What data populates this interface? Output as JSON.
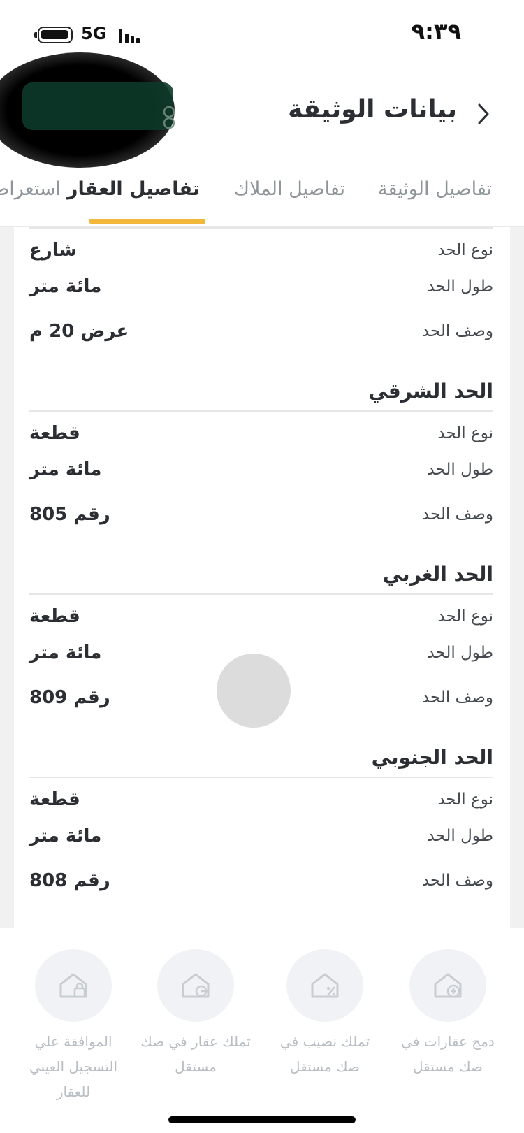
{
  "status_bar": {
    "time": "٩:٣٩",
    "network": "5G"
  },
  "header": {
    "title": "بيانات الوثيقة"
  },
  "tabs": [
    {
      "label": "تفاصيل الوثيقة",
      "active": false
    },
    {
      "label": "تفاصيل الملاك",
      "active": false
    },
    {
      "label": "تفاصيل العقار",
      "active": true
    },
    {
      "label": "استعراض",
      "active": false
    }
  ],
  "boundaries": [
    {
      "title": "",
      "rows": [
        {
          "label": "نوع الحد",
          "value": "شارع"
        },
        {
          "label": "طول الحد",
          "value": "مائة متر"
        },
        {
          "label": "وصف الحد",
          "value": "عرض 20 م"
        }
      ]
    },
    {
      "title": "الحد الشرقي",
      "rows": [
        {
          "label": "نوع الحد",
          "value": "قطعة"
        },
        {
          "label": "طول الحد",
          "value": "مائة متر"
        },
        {
          "label": "وصف الحد",
          "value": "رقم 805"
        }
      ]
    },
    {
      "title": "الحد الغربي",
      "rows": [
        {
          "label": "نوع الحد",
          "value": "قطعة"
        },
        {
          "label": "طول الحد",
          "value": "مائة متر"
        },
        {
          "label": "وصف الحد",
          "value": "رقم 809"
        }
      ]
    },
    {
      "title": "الحد الجنوبي",
      "rows": [
        {
          "label": "نوع الحد",
          "value": "قطعة"
        },
        {
          "label": "طول الحد",
          "value": "مائة متر"
        },
        {
          "label": "وصف الحد",
          "value": "رقم 808"
        }
      ]
    }
  ],
  "actions": [
    {
      "label": "دمج عقارات في صك مستقل",
      "icon": "home-plus-icon"
    },
    {
      "label": "تملك نصيب في صك مستقل",
      "icon": "home-percent-icon"
    },
    {
      "label": "تملك عقار في صك مستقل",
      "icon": "home-key-icon"
    },
    {
      "label": "الموافقة علي التسجيل العيني للعقار",
      "icon": "home-lock-icon"
    }
  ],
  "colors": {
    "accent": "#f1b83b",
    "text": "#2b2f33",
    "muted": "#8d9599",
    "action_label": "#b8bec3"
  }
}
